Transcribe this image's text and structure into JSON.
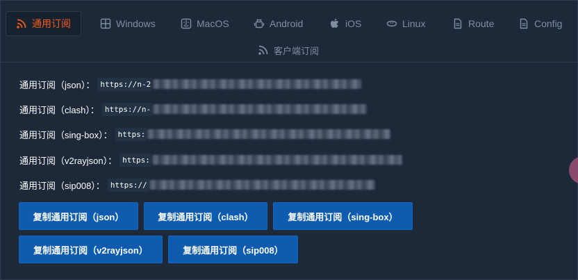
{
  "tabs": [
    {
      "label": "通用订阅",
      "icon": "rss-icon",
      "active": true
    },
    {
      "label": "Windows",
      "icon": "windows-icon"
    },
    {
      "label": "MacOS",
      "icon": "macos-icon"
    },
    {
      "label": "Android",
      "icon": "android-icon"
    },
    {
      "label": "iOS",
      "icon": "apple-icon"
    },
    {
      "label": "Linux",
      "icon": "linux-icon"
    },
    {
      "label": "Route",
      "icon": "file-icon"
    },
    {
      "label": "Config",
      "icon": "file-icon"
    }
  ],
  "sub_tab": {
    "label": "客户端订阅",
    "icon": "rss-icon"
  },
  "subscriptions": [
    {
      "label": "通用订阅（json）：",
      "url_visible": "https://n-2"
    },
    {
      "label": "通用订阅（clash）：",
      "url_visible": "https://n-"
    },
    {
      "label": "通用订阅（sing-box）：",
      "url_visible": "https:"
    },
    {
      "label": "通用订阅（v2rayjson）：",
      "url_visible": "https:"
    },
    {
      "label": "通用订阅（sip008）：",
      "url_visible": "https://"
    }
  ],
  "buttons": [
    {
      "label": "复制通用订阅（json）"
    },
    {
      "label": "复制通用订阅（clash）"
    },
    {
      "label": "复制通用订阅（sing-box）"
    },
    {
      "label": "复制通用订阅（v2rayjson）"
    },
    {
      "label": "复制通用订阅（sip008）"
    }
  ],
  "colors": {
    "active_tab": "#f25a1f",
    "button": "#0d5cb0",
    "panel": "#1d2939"
  }
}
